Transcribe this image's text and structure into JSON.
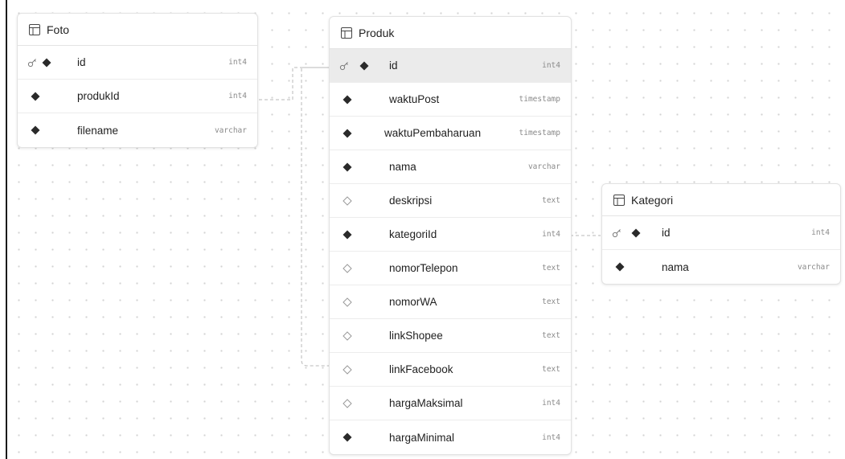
{
  "colors": {
    "connector": "#b8b8b8",
    "diamond_filled": "#2a2a2a",
    "diamond_outline": "#9a9a9a",
    "highlight_row": "#ebebeb",
    "canvas_dot": "#d3d3d3"
  },
  "icons": {
    "table": "table-grid-icon",
    "primary_key": "key-icon",
    "not_null": "filled-diamond-icon",
    "nullable": "outline-diamond-icon"
  },
  "tables": {
    "foto": {
      "name": "Foto",
      "columns": [
        {
          "name": "id",
          "type": "int4",
          "pk": true,
          "nullable": false
        },
        {
          "name": "produkId",
          "type": "int4",
          "pk": false,
          "nullable": false
        },
        {
          "name": "filename",
          "type": "varchar",
          "pk": false,
          "nullable": false
        }
      ]
    },
    "produk": {
      "name": "Produk",
      "columns": [
        {
          "name": "id",
          "type": "int4",
          "pk": true,
          "nullable": false
        },
        {
          "name": "waktuPost",
          "type": "timestamp",
          "pk": false,
          "nullable": false
        },
        {
          "name": "waktuPembaharuan",
          "type": "timestamp",
          "pk": false,
          "nullable": false
        },
        {
          "name": "nama",
          "type": "varchar",
          "pk": false,
          "nullable": false
        },
        {
          "name": "deskripsi",
          "type": "text",
          "pk": false,
          "nullable": true
        },
        {
          "name": "kategoriId",
          "type": "int4",
          "pk": false,
          "nullable": false
        },
        {
          "name": "nomorTelepon",
          "type": "text",
          "pk": false,
          "nullable": true
        },
        {
          "name": "nomorWA",
          "type": "text",
          "pk": false,
          "nullable": true
        },
        {
          "name": "linkShopee",
          "type": "text",
          "pk": false,
          "nullable": true
        },
        {
          "name": "linkFacebook",
          "type": "text",
          "pk": false,
          "nullable": true
        },
        {
          "name": "hargaMaksimal",
          "type": "int4",
          "pk": false,
          "nullable": true
        },
        {
          "name": "hargaMinimal",
          "type": "int4",
          "pk": false,
          "nullable": false
        }
      ]
    },
    "kategori": {
      "name": "Kategori",
      "columns": [
        {
          "name": "id",
          "type": "int4",
          "pk": true,
          "nullable": false
        },
        {
          "name": "nama",
          "type": "varchar",
          "pk": false,
          "nullable": false
        }
      ]
    }
  }
}
